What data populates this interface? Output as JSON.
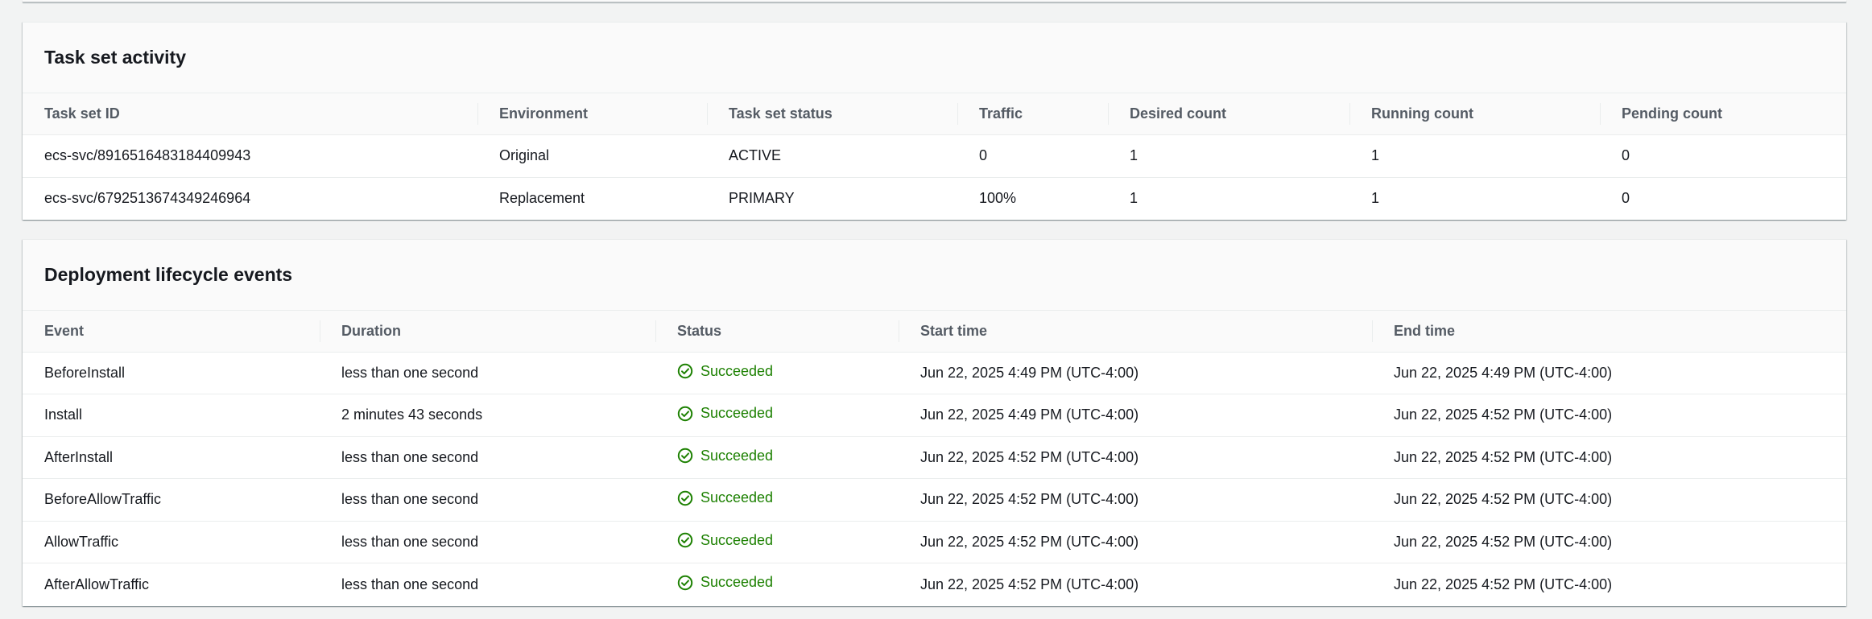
{
  "task_set_activity": {
    "title": "Task set activity",
    "columns": [
      "Task set ID",
      "Environment",
      "Task set status",
      "Traffic",
      "Desired count",
      "Running count",
      "Pending count"
    ],
    "rows": [
      [
        "ecs-svc/8916516483184409943",
        "Original",
        "ACTIVE",
        "0",
        "1",
        "1",
        "0"
      ],
      [
        "ecs-svc/6792513674349246964",
        "Replacement",
        "PRIMARY",
        "100%",
        "1",
        "1",
        "0"
      ]
    ]
  },
  "lifecycle_events": {
    "title": "Deployment lifecycle events",
    "columns": [
      "Event",
      "Duration",
      "Status",
      "Start time",
      "End time"
    ],
    "status_icon": "check-circle-icon",
    "status_color": "#1d8102",
    "rows": [
      [
        "BeforeInstall",
        "less than one second",
        "Succeeded",
        "Jun 22, 2025 4:49 PM (UTC-4:00)",
        "Jun 22, 2025 4:49 PM (UTC-4:00)"
      ],
      [
        "Install",
        "2 minutes 43 seconds",
        "Succeeded",
        "Jun 22, 2025 4:49 PM (UTC-4:00)",
        "Jun 22, 2025 4:52 PM (UTC-4:00)"
      ],
      [
        "AfterInstall",
        "less than one second",
        "Succeeded",
        "Jun 22, 2025 4:52 PM (UTC-4:00)",
        "Jun 22, 2025 4:52 PM (UTC-4:00)"
      ],
      [
        "BeforeAllowTraffic",
        "less than one second",
        "Succeeded",
        "Jun 22, 2025 4:52 PM (UTC-4:00)",
        "Jun 22, 2025 4:52 PM (UTC-4:00)"
      ],
      [
        "AllowTraffic",
        "less than one second",
        "Succeeded",
        "Jun 22, 2025 4:52 PM (UTC-4:00)",
        "Jun 22, 2025 4:52 PM (UTC-4:00)"
      ],
      [
        "AfterAllowTraffic",
        "less than one second",
        "Succeeded",
        "Jun 22, 2025 4:52 PM (UTC-4:00)",
        "Jun 22, 2025 4:52 PM (UTC-4:00)"
      ]
    ]
  }
}
